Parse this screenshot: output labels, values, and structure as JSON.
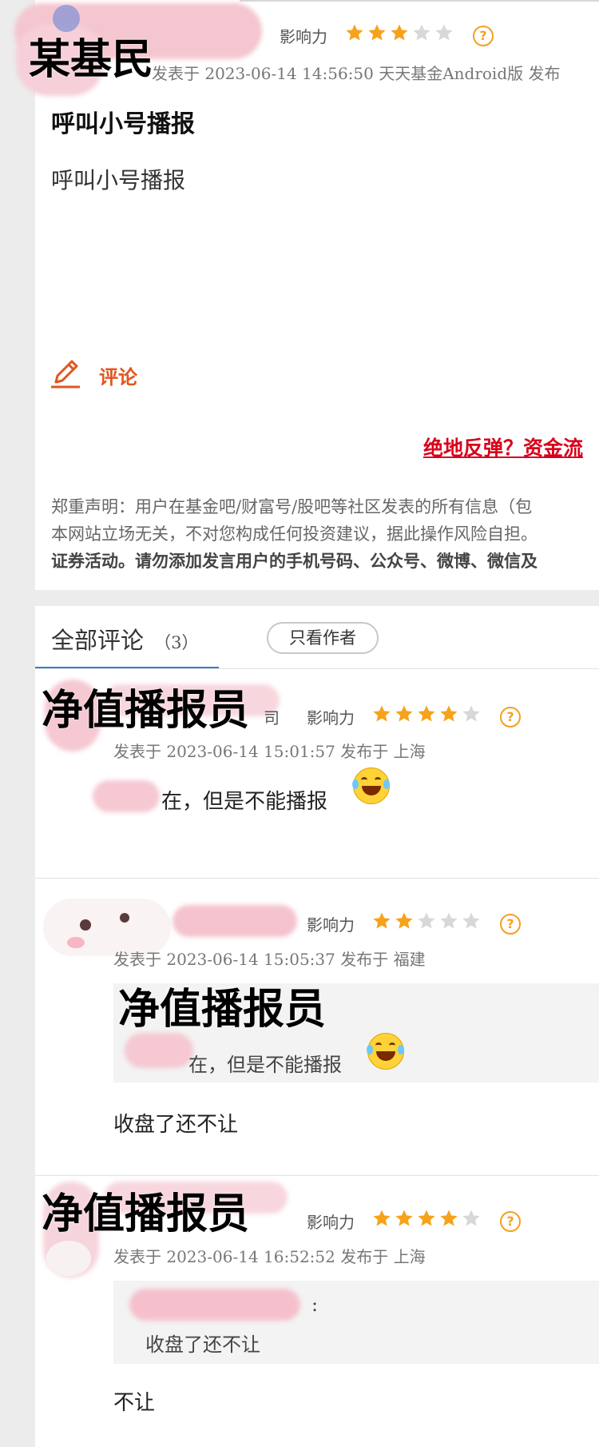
{
  "post": {
    "author_overlay": "某基民",
    "influence_label": "影响力",
    "rating": 3,
    "meta": "发表于 2023-06-14 14:56:50 天天基金Android版 发布",
    "title": "呼叫小号播报",
    "body": "呼叫小号播报",
    "comment_label": "评论",
    "promo_link": "绝地反弹？资金流",
    "disclaimer": [
      "郑重声明：用户在基金吧/财富号/股吧等社区发表的所有信息（包",
      "本网站立场无关，不对您构成任何投资建议，据此操作风险自担。",
      "证券活动。请勿添加发言用户的手机号码、公众号、微博、微信及"
    ]
  },
  "comments_section": {
    "tab_label": "全部评论",
    "count": "（3）",
    "author_only_button": "只看作者"
  },
  "comments": [
    {
      "name_overlay": "净值播报员",
      "name_fragment": "司",
      "influence_label": "影响力",
      "rating": 4,
      "time": "发表于 2023-06-14 15:01:57 发布于 上海",
      "text": "在，但是不能播报"
    },
    {
      "influence_label": "影响力",
      "rating": 2,
      "time": "发表于 2023-06-14 15:05:37 发布于 福建",
      "quote_overlay": "净值播报员",
      "quote_text": "在，但是不能播报",
      "text": "收盘了还不让"
    },
    {
      "name_overlay": "净值播报员",
      "influence_label": "影响力",
      "rating": 4,
      "time": "发表于 2023-06-14 16:52:52 发布于 上海",
      "quote_colon": ":",
      "quote_text": "收盘了还不让",
      "text": "不让"
    }
  ],
  "colors": {
    "star_on": "#f7a21b",
    "star_off": "#d8d8d8",
    "accent": "#e0561e",
    "link": "#d9001b",
    "tab_underline": "#3a7bd5"
  },
  "icons": [
    "star-icon",
    "help-icon",
    "pencil-icon",
    "laughing-emoji-icon"
  ]
}
